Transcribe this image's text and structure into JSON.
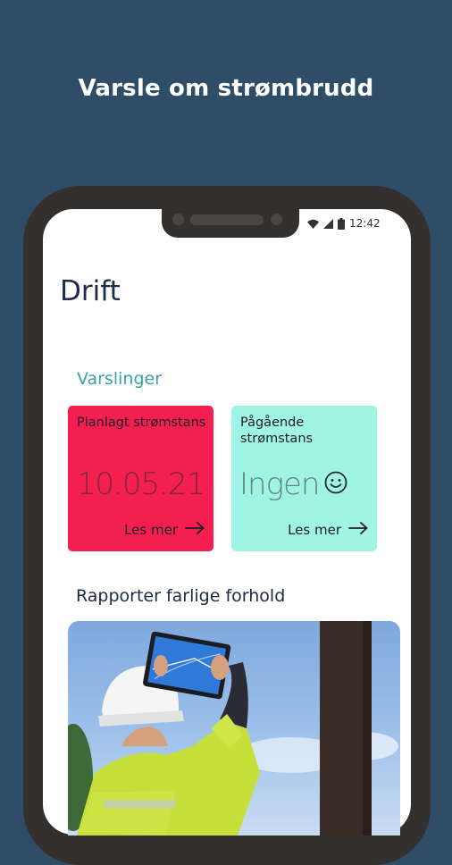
{
  "headline": "Varsle om strømbrudd",
  "status_bar": {
    "time": "12:42"
  },
  "app": {
    "title": "Drift",
    "notifications_label": "Varslinger",
    "cards": [
      {
        "title": "Planlagt strømstans",
        "value": "10.05.21",
        "link": "Les mer",
        "color": "#f3204f"
      },
      {
        "title": "Pågående strømstans",
        "value": "Ingen",
        "link": "Les mer",
        "color": "#9ff4e4"
      }
    ],
    "report_label": "Rapporter farlige forhold"
  },
  "icons": [
    "wifi-icon",
    "signal-icon",
    "battery-icon",
    "smiley-icon",
    "arrow-right-icon"
  ]
}
